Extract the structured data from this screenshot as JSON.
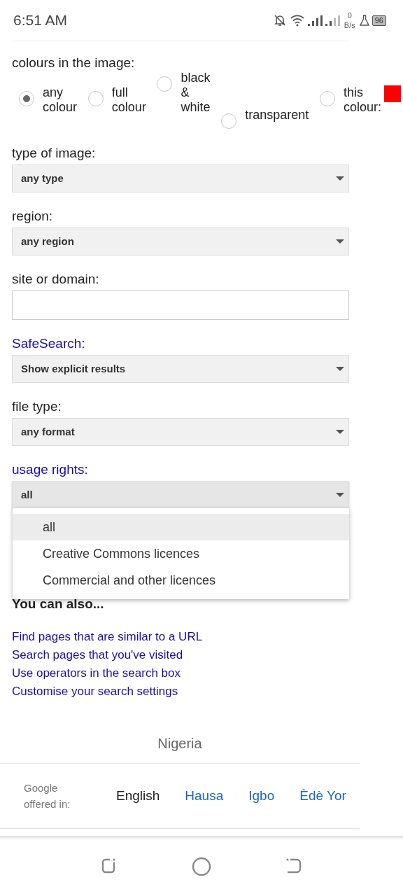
{
  "status_bar": {
    "time": "6:51 AM",
    "net_speed_value": "0",
    "net_speed_unit": "B/s",
    "battery": "96"
  },
  "colours": {
    "label": "colours in the image:",
    "options": [
      {
        "kind": "plain",
        "lines": [
          "any",
          "colour"
        ],
        "selected": true
      },
      {
        "kind": "plain",
        "lines": [
          "full",
          "colour"
        ],
        "selected": false
      },
      {
        "kind": "plain",
        "lines": [
          "black",
          "&",
          "white"
        ],
        "selected": false
      },
      {
        "kind": "plain",
        "lines": [
          "transparent"
        ],
        "selected": false
      },
      {
        "kind": "swatch",
        "lines": [
          "this",
          "colour:"
        ],
        "selected": false,
        "color": "#ff0000"
      }
    ]
  },
  "fields": [
    {
      "kind": "select",
      "label": "type of image:",
      "value": "any type",
      "link": false
    },
    {
      "kind": "select",
      "label": "region:",
      "value": "any region",
      "link": false
    },
    {
      "kind": "input",
      "label": "site or domain:",
      "link": false
    },
    {
      "kind": "select",
      "label": "SafeSearch:",
      "value": "Show explicit results",
      "link": true
    },
    {
      "kind": "select",
      "label": "file type:",
      "value": "any format",
      "link": false
    },
    {
      "kind": "select",
      "label": "usage rights:",
      "value": "all",
      "link": true,
      "open": true
    }
  ],
  "dropdown": {
    "options": [
      {
        "label": "all",
        "selected": true
      },
      {
        "label": "Creative Commons licences",
        "selected": false
      },
      {
        "label": "Commercial and other licences",
        "selected": false
      }
    ]
  },
  "also": {
    "heading": "You can also...",
    "links": [
      "Find pages that are similar to a URL",
      "Search pages that you've visited",
      "Use operators in the search box",
      "Customise your search settings"
    ]
  },
  "country": "Nigeria",
  "languages": {
    "label": "Google offered in:",
    "items": [
      {
        "label": "English",
        "selected": true
      },
      {
        "label": "Hausa",
        "selected": false
      },
      {
        "label": "Igbo",
        "selected": false
      },
      {
        "label": "Èdè Yor",
        "selected": false
      }
    ]
  }
}
